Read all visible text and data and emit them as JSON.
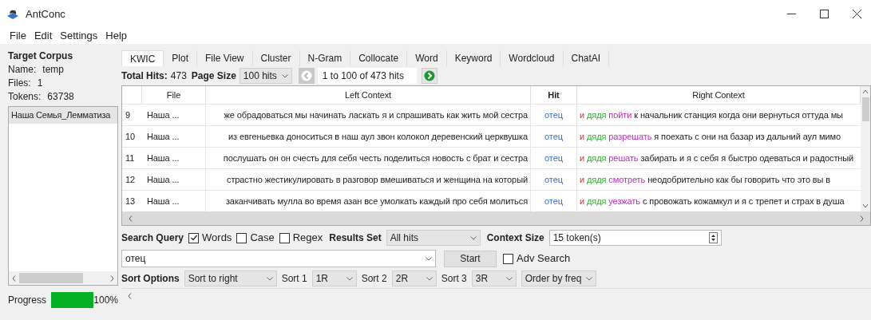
{
  "window": {
    "title": "AntConc"
  },
  "menu": [
    "File",
    "Edit",
    "Settings",
    "Help"
  ],
  "corpus": {
    "title": "Target Corpus",
    "name_label": "Name:",
    "name": "temp",
    "files_label": "Files:",
    "files": "1",
    "tokens_label": "Tokens:",
    "tokens": "63738",
    "files_list": [
      {
        "label": "Наша Семья_Лемматиза",
        "selected": true
      }
    ]
  },
  "progress": {
    "label": "Progress",
    "level": 1,
    "reading": "100%"
  },
  "tabs": [
    {
      "label": "KWIC",
      "selected": true
    },
    {
      "label": "Plot",
      "selected": false
    },
    {
      "label": "File View",
      "selected": false
    },
    {
      "label": "Cluster",
      "selected": false
    },
    {
      "label": "N-Gram",
      "selected": false
    },
    {
      "label": "Collocate",
      "selected": false
    },
    {
      "label": "Word",
      "selected": false
    },
    {
      "label": "Keyword",
      "selected": false
    },
    {
      "label": "Wordcloud",
      "selected": false
    },
    {
      "label": "ChatAI",
      "selected": false
    }
  ],
  "hits_bar": {
    "total_label": "Total Hits:",
    "total": "473",
    "page_size_label": "Page Size",
    "page_size": "100 hits",
    "range": "1 to 100 of 473 hits"
  },
  "table": {
    "columns": [
      "File",
      "Left Context",
      "Hit",
      "Right Context"
    ],
    "rows": [
      {
        "index": "9",
        "file": "Наша ...",
        "left": "же обрадоваться мы начинать ласкать я и спрашивать как жить мой сестра",
        "hit": "отец",
        "right": [
          "и",
          "дядя",
          "пойти",
          "к начальник станция когда они вернуться оттуда мы"
        ]
      },
      {
        "index": "10",
        "file": "Наша ...",
        "left": "из евгеньевка доноситься в наш аул звон колокол деревенский церквушка",
        "hit": "отец",
        "right": [
          "и",
          "дядя",
          "разрешать",
          "я поехать с они на базар из дальний аул мимо"
        ]
      },
      {
        "index": "11",
        "file": "Наша ...",
        "left": "послушать он он счесть для себя честь поделиться новость с брат и сестра",
        "hit": "отец",
        "right": [
          "и",
          "дядя",
          "решать",
          "забирать и я с себя я быстро одеваться и радостный"
        ]
      },
      {
        "index": "12",
        "file": "Наша ...",
        "left": "страстно жестикулировать в разговор вмешиваться и женщина на который",
        "hit": "отец",
        "right": [
          "и",
          "дядя",
          "смотреть",
          "неодобрительно как бы говорить что это вы в"
        ]
      },
      {
        "index": "13",
        "file": "Наша ...",
        "left": "заканчивать мулла во время азан все умолкать каждый про себя молиться",
        "hit": "отец",
        "right": [
          "и",
          "дядя",
          "уезжать",
          "с провожать кожамкул и я с трепет и страх в душа"
        ]
      }
    ]
  },
  "search": {
    "label": "Search Query",
    "options": [
      {
        "label": "Words",
        "checked": true
      },
      {
        "label": "Case",
        "checked": false
      },
      {
        "label": "Regex",
        "checked": false
      }
    ],
    "results_set_label": "Results Set",
    "results_set": "All hits",
    "context_size_label": "Context Size",
    "context_size": "15 token(s)",
    "query": "отец",
    "start": "Start",
    "adv_search": {
      "label": "Adv Search",
      "checked": false
    }
  },
  "sort": {
    "label": "Sort Options",
    "mode": "Sort to right",
    "sorts": [
      {
        "label": "Sort 1",
        "value": "1R"
      },
      {
        "label": "Sort 2",
        "value": "2R"
      },
      {
        "label": "Sort 3",
        "value": "3R"
      }
    ],
    "order": "Order by freq"
  }
}
